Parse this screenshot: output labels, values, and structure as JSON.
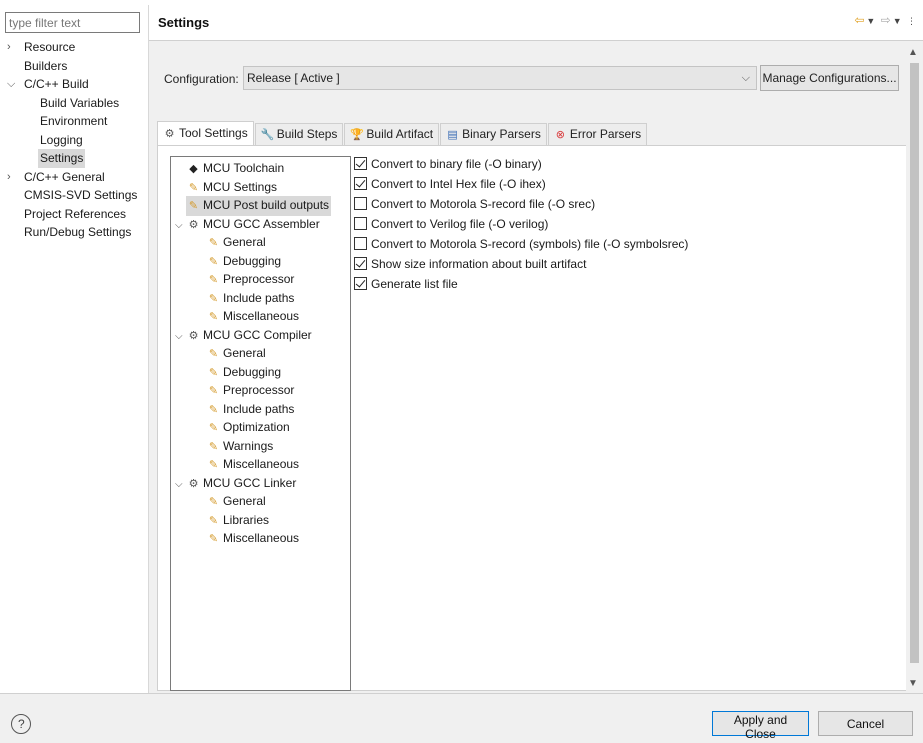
{
  "filter": {
    "placeholder": "type filter text"
  },
  "nav": {
    "items": [
      {
        "label": "Resource",
        "depth": 0,
        "twisty": "collapsed"
      },
      {
        "label": "Builders",
        "depth": 0,
        "twisty": "none"
      },
      {
        "label": "C/C++ Build",
        "depth": 0,
        "twisty": "expanded"
      },
      {
        "label": "Build Variables",
        "depth": 1,
        "twisty": "none"
      },
      {
        "label": "Environment",
        "depth": 1,
        "twisty": "none"
      },
      {
        "label": "Logging",
        "depth": 1,
        "twisty": "none"
      },
      {
        "label": "Settings",
        "depth": 1,
        "twisty": "none",
        "selected": true
      },
      {
        "label": "C/C++ General",
        "depth": 0,
        "twisty": "collapsed"
      },
      {
        "label": "CMSIS-SVD Settings",
        "depth": 0,
        "twisty": "none"
      },
      {
        "label": "Project References",
        "depth": 0,
        "twisty": "none"
      },
      {
        "label": "Run/Debug Settings",
        "depth": 0,
        "twisty": "none"
      }
    ]
  },
  "header": {
    "title": "Settings",
    "icons": [
      "back-arrow-icon",
      "dropdown-icon",
      "forward-arrow-icon",
      "dropdown-icon",
      "view-menu-icon"
    ]
  },
  "configuration": {
    "label": "Configuration:",
    "value": "Release  [ Active ]",
    "manage_label": "Manage Configurations..."
  },
  "tabs": [
    {
      "label": "Tool Settings",
      "icon": "gear-icon",
      "active": true
    },
    {
      "label": "Build Steps",
      "icon": "wrench-icon"
    },
    {
      "label": "Build Artifact",
      "icon": "trophy-icon"
    },
    {
      "label": "Binary Parsers",
      "icon": "binary-icon"
    },
    {
      "label": "Error Parsers",
      "icon": "error-icon"
    }
  ],
  "tool_tree": [
    {
      "label": "MCU Toolchain",
      "depth": 0,
      "icon": "tool",
      "twisty": "none"
    },
    {
      "label": "MCU Settings",
      "depth": 0,
      "icon": "option",
      "twisty": "none"
    },
    {
      "label": "MCU Post build outputs",
      "depth": 0,
      "icon": "option",
      "twisty": "none",
      "selected": true
    },
    {
      "label": "MCU GCC Assembler",
      "depth": 0,
      "icon": "toolchain",
      "twisty": "expanded"
    },
    {
      "label": "General",
      "depth": 1,
      "icon": "option"
    },
    {
      "label": "Debugging",
      "depth": 1,
      "icon": "option"
    },
    {
      "label": "Preprocessor",
      "depth": 1,
      "icon": "option"
    },
    {
      "label": "Include paths",
      "depth": 1,
      "icon": "option"
    },
    {
      "label": "Miscellaneous",
      "depth": 1,
      "icon": "option"
    },
    {
      "label": "MCU GCC Compiler",
      "depth": 0,
      "icon": "toolchain",
      "twisty": "expanded"
    },
    {
      "label": "General",
      "depth": 1,
      "icon": "option"
    },
    {
      "label": "Debugging",
      "depth": 1,
      "icon": "option"
    },
    {
      "label": "Preprocessor",
      "depth": 1,
      "icon": "option"
    },
    {
      "label": "Include paths",
      "depth": 1,
      "icon": "option"
    },
    {
      "label": "Optimization",
      "depth": 1,
      "icon": "option"
    },
    {
      "label": "Warnings",
      "depth": 1,
      "icon": "option"
    },
    {
      "label": "Miscellaneous",
      "depth": 1,
      "icon": "option"
    },
    {
      "label": "MCU GCC Linker",
      "depth": 0,
      "icon": "toolchain",
      "twisty": "expanded"
    },
    {
      "label": "General",
      "depth": 1,
      "icon": "option"
    },
    {
      "label": "Libraries",
      "depth": 1,
      "icon": "option"
    },
    {
      "label": "Miscellaneous",
      "depth": 1,
      "icon": "option"
    }
  ],
  "options": [
    {
      "label": "Convert to binary file (-O binary)",
      "checked": true
    },
    {
      "label": "Convert to Intel Hex file (-O ihex)",
      "checked": true
    },
    {
      "label": "Convert to Motorola S-record file (-O srec)",
      "checked": false
    },
    {
      "label": "Convert to Verilog file (-O verilog)",
      "checked": false
    },
    {
      "label": "Convert to Motorola S-record (symbols) file (-O symbolsrec)",
      "checked": false
    },
    {
      "label": "Show size information about built artifact",
      "checked": true
    },
    {
      "label": "Generate list file",
      "checked": true
    }
  ],
  "footer": {
    "help_icon": "help-icon",
    "help_glyph": "?",
    "apply_label": "Apply and Close",
    "cancel_label": "Cancel"
  },
  "colors": {
    "accent": "#0078d7",
    "selection": "#d9d9d9",
    "panel": "#f0f0f0"
  }
}
